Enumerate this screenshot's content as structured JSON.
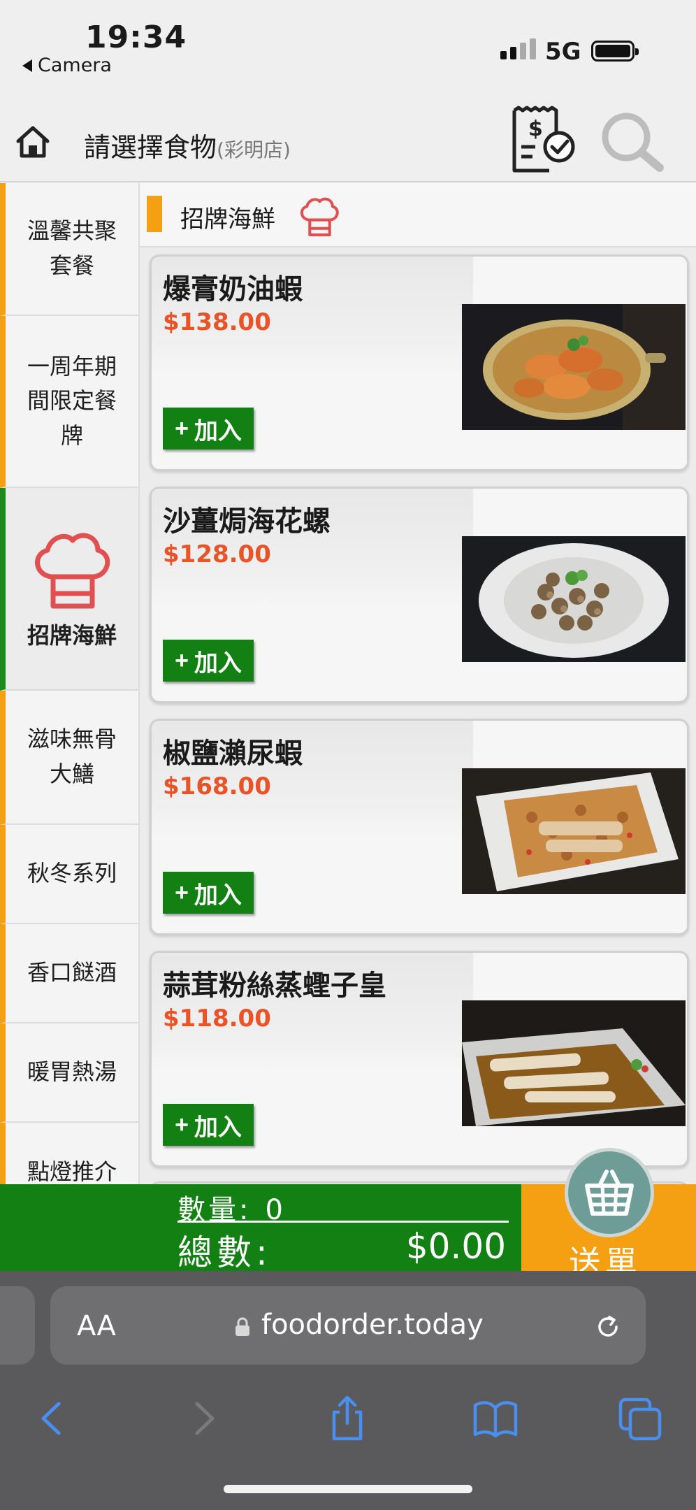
{
  "status_bar": {
    "time": "19:34",
    "back_label": "Camera",
    "network": "5G",
    "icons": [
      "signal-icon",
      "battery-icon"
    ]
  },
  "header": {
    "title": "請選擇食物",
    "store": "(彩明店)",
    "icons": [
      "home-icon",
      "receipt-icon",
      "search-icon"
    ]
  },
  "sidebar": {
    "items": [
      {
        "lines": [
          "溫馨共聚",
          "套餐"
        ],
        "active": false
      },
      {
        "lines": [
          "一周年期",
          "間限定餐",
          "牌"
        ],
        "active": false
      },
      {
        "lines": [
          "招牌海鮮"
        ],
        "active": true,
        "icon": "chef-hat-icon"
      },
      {
        "lines": [
          "滋味無骨",
          "大鱔"
        ],
        "active": false
      },
      {
        "lines": [
          "秋冬系列"
        ],
        "active": false
      },
      {
        "lines": [
          "香口餸酒"
        ],
        "active": false
      },
      {
        "lines": [
          "暖胃熱湯"
        ],
        "active": false
      },
      {
        "lines": [
          "點燈推介"
        ],
        "active": false
      }
    ]
  },
  "section": {
    "title": "招牌海鮮",
    "icon": "chef-hat-icon"
  },
  "items": [
    {
      "name": "爆膏奶油蝦",
      "price": "$138.00",
      "add_label": "加入",
      "photo": "shrimp-pan"
    },
    {
      "name": "沙薑焗海花螺",
      "price": "$128.00",
      "add_label": "加入",
      "photo": "snails-plate"
    },
    {
      "name": "椒鹽瀨尿蝦",
      "price": "$168.00",
      "add_label": "加入",
      "photo": "mantis-shrimp-plate"
    },
    {
      "name": "蒜茸粉絲蒸蟶子皇",
      "price": "$118.00",
      "add_label": "加入",
      "photo": "razor-clams-plate"
    }
  ],
  "order": {
    "qty_label": "數量:",
    "qty_value": "0",
    "total_label": "總數:",
    "total_value": "$0.00",
    "send_label": "送單"
  },
  "browser": {
    "text_size_label": "AA",
    "url": "foodorder.today",
    "icons": [
      "back-icon",
      "forward-icon",
      "share-icon",
      "bookmarks-icon",
      "tabs-icon",
      "reload-icon",
      "lock-icon"
    ]
  },
  "colors": {
    "accent_orange": "#f5a012",
    "accent_green": "#128012",
    "price_red": "#e8542a",
    "chef_red": "#e05050",
    "ios_blue": "#4a8ff0"
  }
}
